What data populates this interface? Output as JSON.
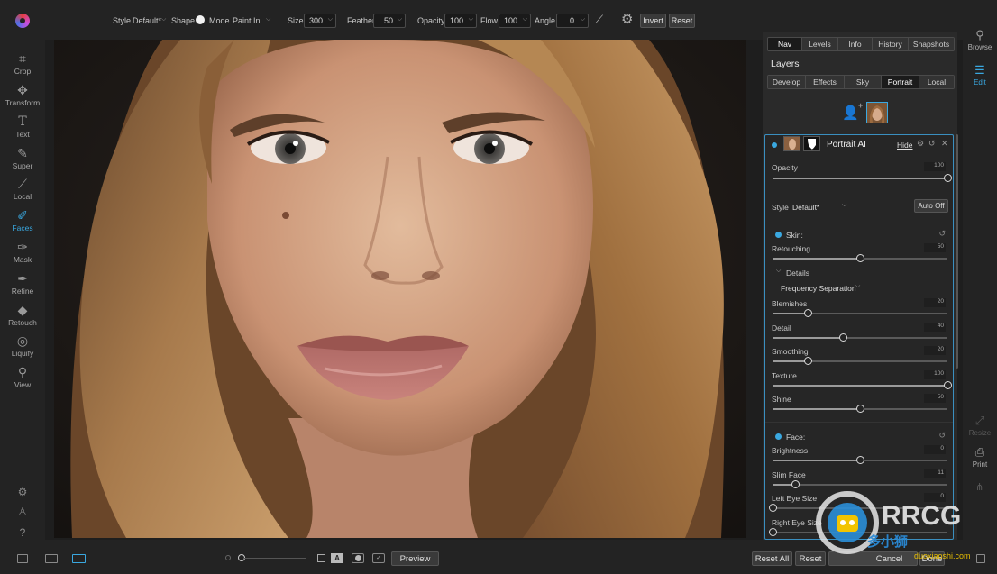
{
  "toolbar": {
    "style_label": "Style",
    "style_value": "Default*",
    "shape_label": "Shape",
    "mode_label": "Mode",
    "mode_value": "Paint In",
    "size_label": "Size",
    "size_value": "300",
    "feather_label": "Feather",
    "feather_value": "50",
    "opacity_label": "Opacity",
    "opacity_value": "100",
    "flow_label": "Flow",
    "flow_value": "100",
    "angle_label": "Angle",
    "angle_value": "0",
    "invert_label": "Invert",
    "reset_label": "Reset"
  },
  "left_tools": [
    {
      "label": "Crop",
      "icon": "crop-icon"
    },
    {
      "label": "Transform",
      "icon": "transform-icon"
    },
    {
      "label": "Text",
      "icon": "text-icon"
    },
    {
      "label": "Super",
      "icon": "super-icon"
    },
    {
      "label": "Local",
      "icon": "local-icon"
    },
    {
      "label": "Faces",
      "icon": "faces-icon",
      "active": true
    },
    {
      "label": "Mask",
      "icon": "mask-icon"
    },
    {
      "label": "Refine",
      "icon": "refine-icon"
    },
    {
      "label": "Retouch",
      "icon": "retouch-icon"
    },
    {
      "label": "Liquify",
      "icon": "liquify-icon"
    },
    {
      "label": "View",
      "icon": "view-icon"
    }
  ],
  "bottombar": {
    "preview_label": "Preview",
    "reset_all_label": "Reset All",
    "reset_label": "Reset",
    "cancel_label": "Cancel",
    "done_label": "Done"
  },
  "panel": {
    "top_tabs": [
      "Nav",
      "Levels",
      "Info",
      "History",
      "Snapshots"
    ],
    "active_top_tab": "Nav",
    "title": "Layers",
    "module_tabs": [
      "Develop",
      "Effects",
      "Sky",
      "Portrait",
      "Local"
    ],
    "active_module_tab": "Portrait",
    "layer": {
      "name": "Portrait AI",
      "hide_label": "Hide",
      "opacity_label": "Opacity",
      "opacity_value": "100",
      "opacity_level": 1.0,
      "style_label": "Style",
      "style_value": "Default*",
      "auto_off_label": "Auto Off",
      "skin_label": "Skin:",
      "retouching_label": "Retouching",
      "retouching_value": "50",
      "retouching_level": 0.5,
      "details_label": "Details",
      "freq_sep_label": "Frequency Separation",
      "sliders": [
        {
          "label": "Blemishes",
          "value": "20",
          "level": 0.2
        },
        {
          "label": "Detail",
          "value": "40",
          "level": 0.4
        },
        {
          "label": "Smoothing",
          "value": "20",
          "level": 0.2
        },
        {
          "label": "Texture",
          "value": "100",
          "level": 1.0
        },
        {
          "label": "Shine",
          "value": "50",
          "level": 0.5
        }
      ],
      "face_label": "Face:",
      "face_sliders": [
        {
          "label": "Brightness",
          "value": "0",
          "level": 0.5
        },
        {
          "label": "Slim Face",
          "value": "11",
          "level": 0.13
        },
        {
          "label": "Left Eye Size",
          "value": "0",
          "level": 0.0
        },
        {
          "label": "Right Eye Size",
          "value": "",
          "level": 0.0
        }
      ]
    }
  },
  "modules": [
    {
      "label": "Browse",
      "icon": "browse-icon"
    },
    {
      "label": "Edit",
      "icon": "edit-icon",
      "active": true
    },
    {
      "label": "Resize",
      "icon": "resize-icon",
      "dim": true
    },
    {
      "label": "Print",
      "icon": "print-icon"
    }
  ],
  "watermark": {
    "brand": "RRCG",
    "site": "duoxiaoshi.com"
  },
  "colors": {
    "accent": "#3aa8e0",
    "background": "#1e1e1e",
    "panel": "#2a2a2a"
  }
}
